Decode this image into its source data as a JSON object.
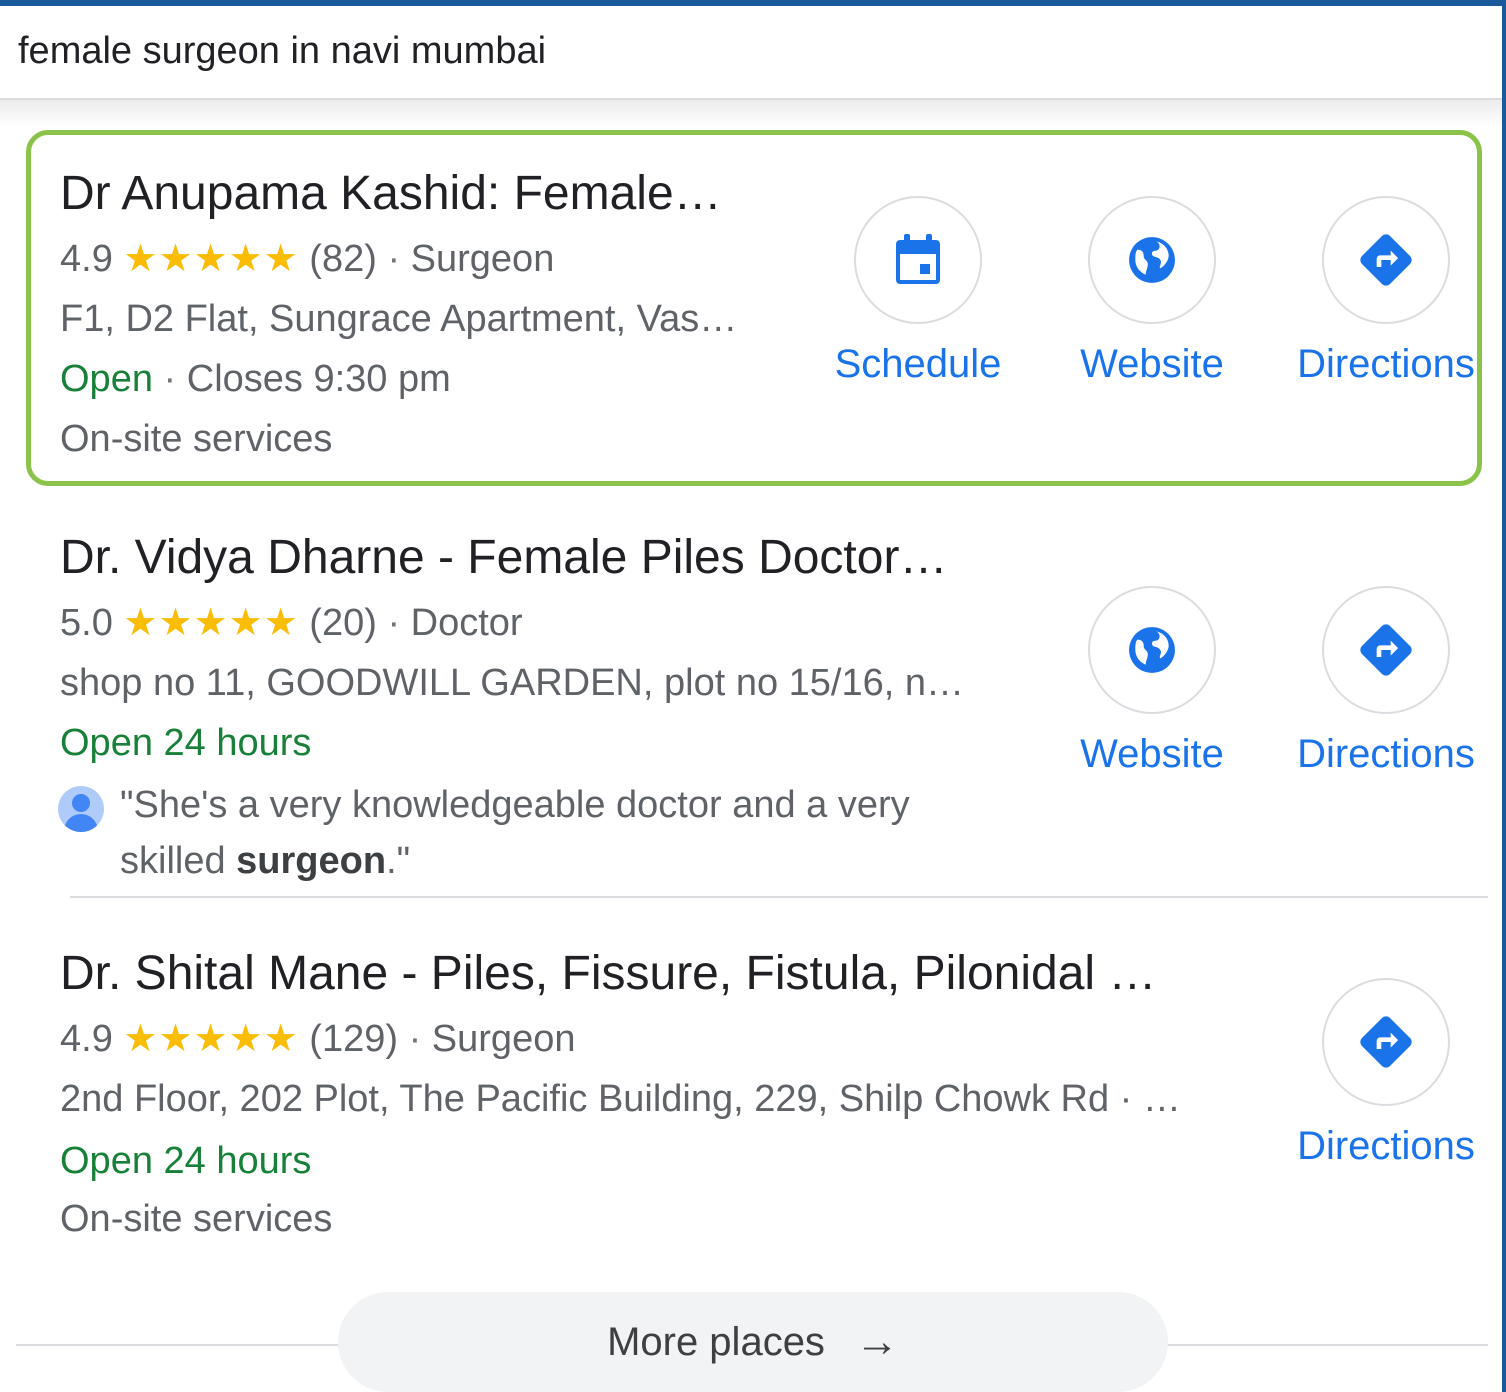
{
  "search": {
    "query": "female surgeon in navi mumbai"
  },
  "stars_text": "★★★★★",
  "colors": {
    "accent": "#1a73e8",
    "open": "#188038",
    "star": "#fbbc04",
    "highlight": "#8bc34a"
  },
  "results": [
    {
      "title": "Dr Anupama Kashid: Female…",
      "rating": "4.9",
      "reviews": "(82)",
      "category": "Surgeon",
      "address": "F1, D2 Flat, Sungrace Apartment, Vas…",
      "status": "Open",
      "hours": "Closes 9:30 pm",
      "extra": "On-site services",
      "actions": [
        {
          "label": "Schedule",
          "icon": "calendar-icon"
        },
        {
          "label": "Website",
          "icon": "globe-icon"
        },
        {
          "label": "Directions",
          "icon": "directions-icon"
        }
      ]
    },
    {
      "title": "Dr. Vidya Dharne - Female Piles Doctor…",
      "rating": "5.0",
      "reviews": "(20)",
      "category": "Doctor",
      "address": "shop no 11, GOODWILL GARDEN, plot no 15/16, n…",
      "status": "Open 24 hours",
      "review_line1": "\"She's a very knowledgeable doctor and a very",
      "review_line2_pre": "skilled ",
      "review_line2_bold": "surgeon",
      "review_line2_post": ".\"",
      "actions": [
        {
          "label": "Website",
          "icon": "globe-icon"
        },
        {
          "label": "Directions",
          "icon": "directions-icon"
        }
      ]
    },
    {
      "title": "Dr. Shital Mane - Piles, Fissure, Fistula, Pilonidal …",
      "rating": "4.9",
      "reviews": "(129)",
      "category": "Surgeon",
      "address": "2nd Floor, 202 Plot, The Pacific Building, 229, Shilp Chowk Rd · …",
      "status": "Open 24 hours",
      "extra": "On-site services",
      "actions": [
        {
          "label": "Directions",
          "icon": "directions-icon"
        }
      ]
    }
  ],
  "more_places": {
    "label": "More places",
    "arrow": "→"
  }
}
